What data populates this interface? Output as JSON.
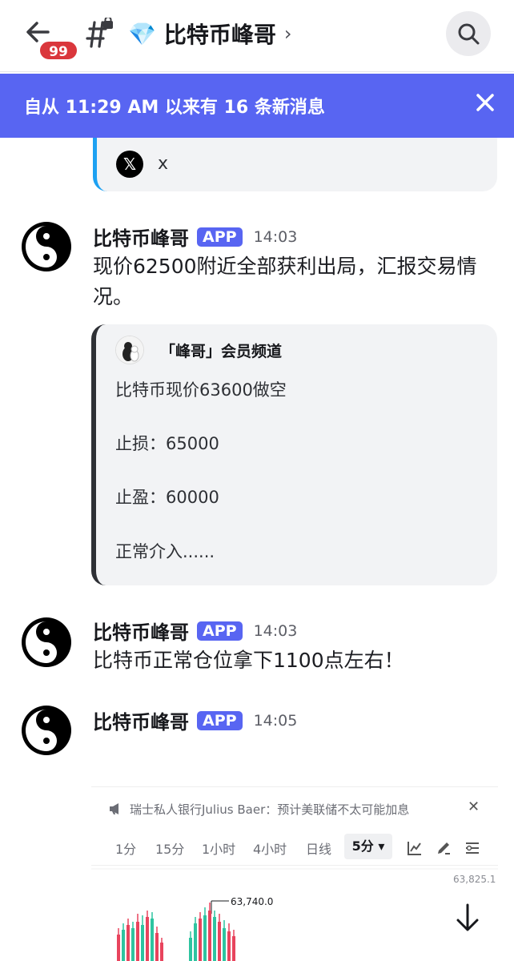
{
  "header": {
    "unread_badge": "99",
    "channel_emoji": "💎",
    "channel_name": "比特币峰哥",
    "chevron": "›",
    "search_icon": "search-icon",
    "back_icon": "back-arrow-icon"
  },
  "banner": {
    "text": "自从 11:29 AM 以来有 16 条新消息",
    "close_icon": "close-icon"
  },
  "prev_embed": {
    "provider": "x"
  },
  "messages": [
    {
      "author": "比特币峰哥",
      "tag": "APP",
      "time": "14:03",
      "text": "现价62500附近全部获利出局，汇报交易情况。",
      "embed": {
        "author": "「峰哥」会员频道",
        "lines": [
          "比特币现价63600做空",
          "止损：65000",
          "止盈：60000",
          "正常介入......"
        ]
      }
    },
    {
      "author": "比特币峰哥",
      "tag": "APP",
      "time": "14:03",
      "text": "比特币正常仓位拿下1100点左右！"
    },
    {
      "author": "比特币峰哥",
      "tag": "APP",
      "time": "14:05",
      "text": ""
    }
  ],
  "chart_card": {
    "ticker": "瑞士私人银行Julius Baer：预计美联储不太可能加息",
    "timeframes": [
      "1分",
      "15分",
      "1小时",
      "4小时",
      "日线"
    ],
    "active_timeframe": "5分 ▾",
    "high_label": "63,825.1",
    "peak_label": "63,740.0",
    "colors": {
      "up": "#2ec4a0",
      "down": "#e8445d"
    }
  }
}
